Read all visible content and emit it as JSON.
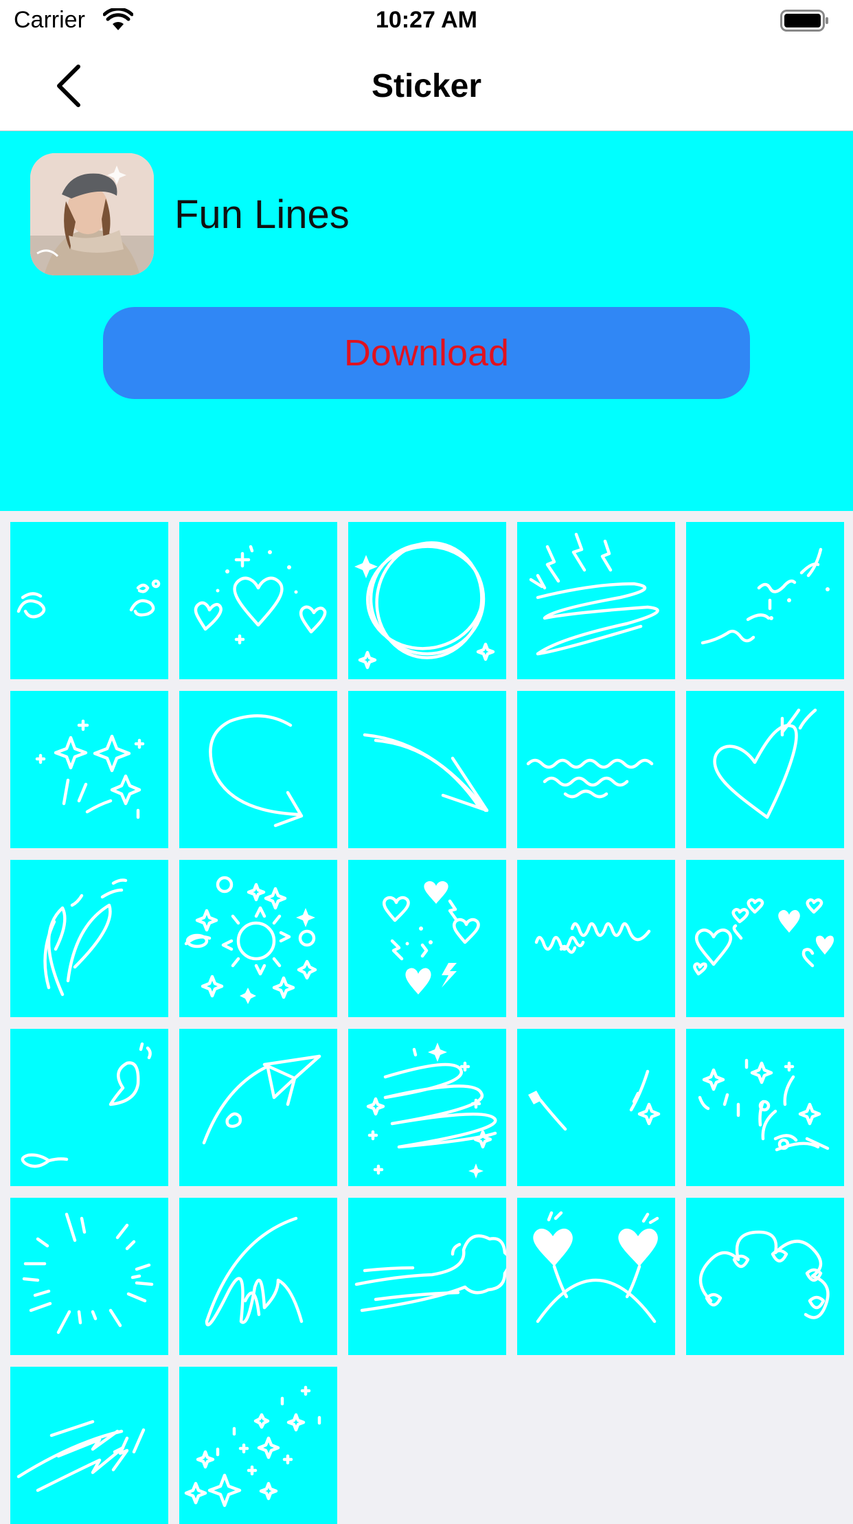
{
  "status_bar": {
    "carrier": "Carrier",
    "time": "10:27 AM"
  },
  "nav": {
    "title": "Sticker"
  },
  "pack": {
    "name": "Fun Lines",
    "download_label": "Download"
  },
  "stickers": [
    {
      "name": "sticker-swirls"
    },
    {
      "name": "sticker-hearts"
    },
    {
      "name": "sticker-circle-scribble"
    },
    {
      "name": "sticker-lightning-swirl"
    },
    {
      "name": "sticker-squiggles"
    },
    {
      "name": "sticker-sparkles"
    },
    {
      "name": "sticker-curved-arrow"
    },
    {
      "name": "sticker-swoosh-arrow"
    },
    {
      "name": "sticker-wavy-lines"
    },
    {
      "name": "sticker-heart-check"
    },
    {
      "name": "sticker-leaf-strokes"
    },
    {
      "name": "sticker-sun-doodles"
    },
    {
      "name": "sticker-hearts-bolts"
    },
    {
      "name": "sticker-loops"
    },
    {
      "name": "sticker-small-hearts"
    },
    {
      "name": "sticker-drops"
    },
    {
      "name": "sticker-paper-plane"
    },
    {
      "name": "sticker-star-swirl"
    },
    {
      "name": "sticker-sparks"
    },
    {
      "name": "sticker-flowers"
    },
    {
      "name": "sticker-burst-lines"
    },
    {
      "name": "sticker-scribble"
    },
    {
      "name": "sticker-wind-cloud"
    },
    {
      "name": "sticker-heart-headband"
    },
    {
      "name": "sticker-curly-cloud"
    },
    {
      "name": "sticker-speed-bolts"
    },
    {
      "name": "sticker-star-dust"
    }
  ],
  "colors": {
    "panel": "#00ffff",
    "button": "#3087f5",
    "button_text": "#e0121f",
    "grid_background": "#f0f0f4"
  }
}
